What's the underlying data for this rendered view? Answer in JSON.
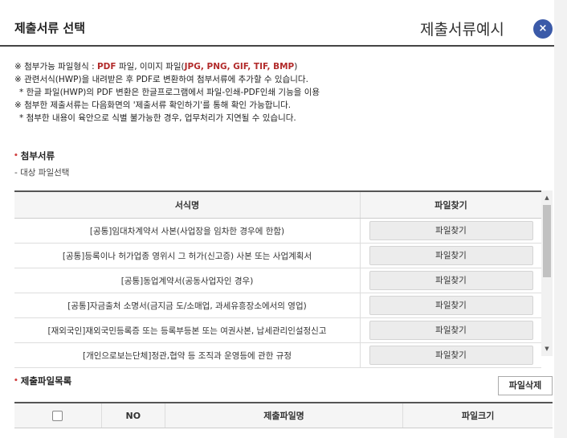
{
  "dialog": {
    "title": "제출서류 선택",
    "example_link": "제출서류예시",
    "close_icon": "×"
  },
  "notes": {
    "line1_prefix": "※ 첨부가능 파일형식 : ",
    "line1_pdf": "PDF",
    "line1_mid": " 파일, 이미지 파일(",
    "line1_formats": "JPG, PNG, GIF, TIF, BMP",
    "line1_suffix": ")",
    "line2": "※ 관련서식(HWP)을 내려받은 후 PDF로 변환하여 첨부서류에 추가할 수 있습니다.",
    "line3": "  * 한글 파일(HWP)의 PDF 변환은 한글프로그램에서 파일-인쇄-PDF인쇄 기능을 이용",
    "line4": "※ 첨부한 제출서류는 다음화면의 '제출서류 확인하기'를 통해 확인 가능합니다.",
    "line5": "  * 첨부한 내용이 육안으로 식별 불가능한 경우, 업무처리가 지연될 수 있습니다."
  },
  "attach_section": {
    "title": "첨부서류",
    "sub_label": "- 대상 파일선택",
    "columns": [
      "서식명",
      "파일찾기"
    ],
    "rows": [
      {
        "name": "[공통]임대차계약서 사본(사업장을 임차한 경우에 한함)",
        "button": "파일찾기"
      },
      {
        "name": "[공통]등록이나 허가업종 영위시 그 허가(신고증) 사본 또는 사업계획서",
        "button": "파일찾기"
      },
      {
        "name": "[공통]동업계약서(공동사업자인 경우)",
        "button": "파일찾기"
      },
      {
        "name": "[공통]자금출처 소명서(금지금 도/소매업, 과세유흥장소에서의 영업)",
        "button": "파일찾기"
      },
      {
        "name": "[재외국인]재외국민등록증 또는 등록부등본 또는 여권사본, 납세관리인설정신고",
        "button": "파일찾기"
      },
      {
        "name": "[개인으로보는단체]정관,협약 등 조직과 운영등에 관한 규정",
        "button": "파일찾기"
      }
    ]
  },
  "submit_section": {
    "title": "제출파일목록",
    "delete_button": "파일삭제",
    "columns": [
      "NO",
      "제출파일명",
      "파일크기"
    ]
  }
}
